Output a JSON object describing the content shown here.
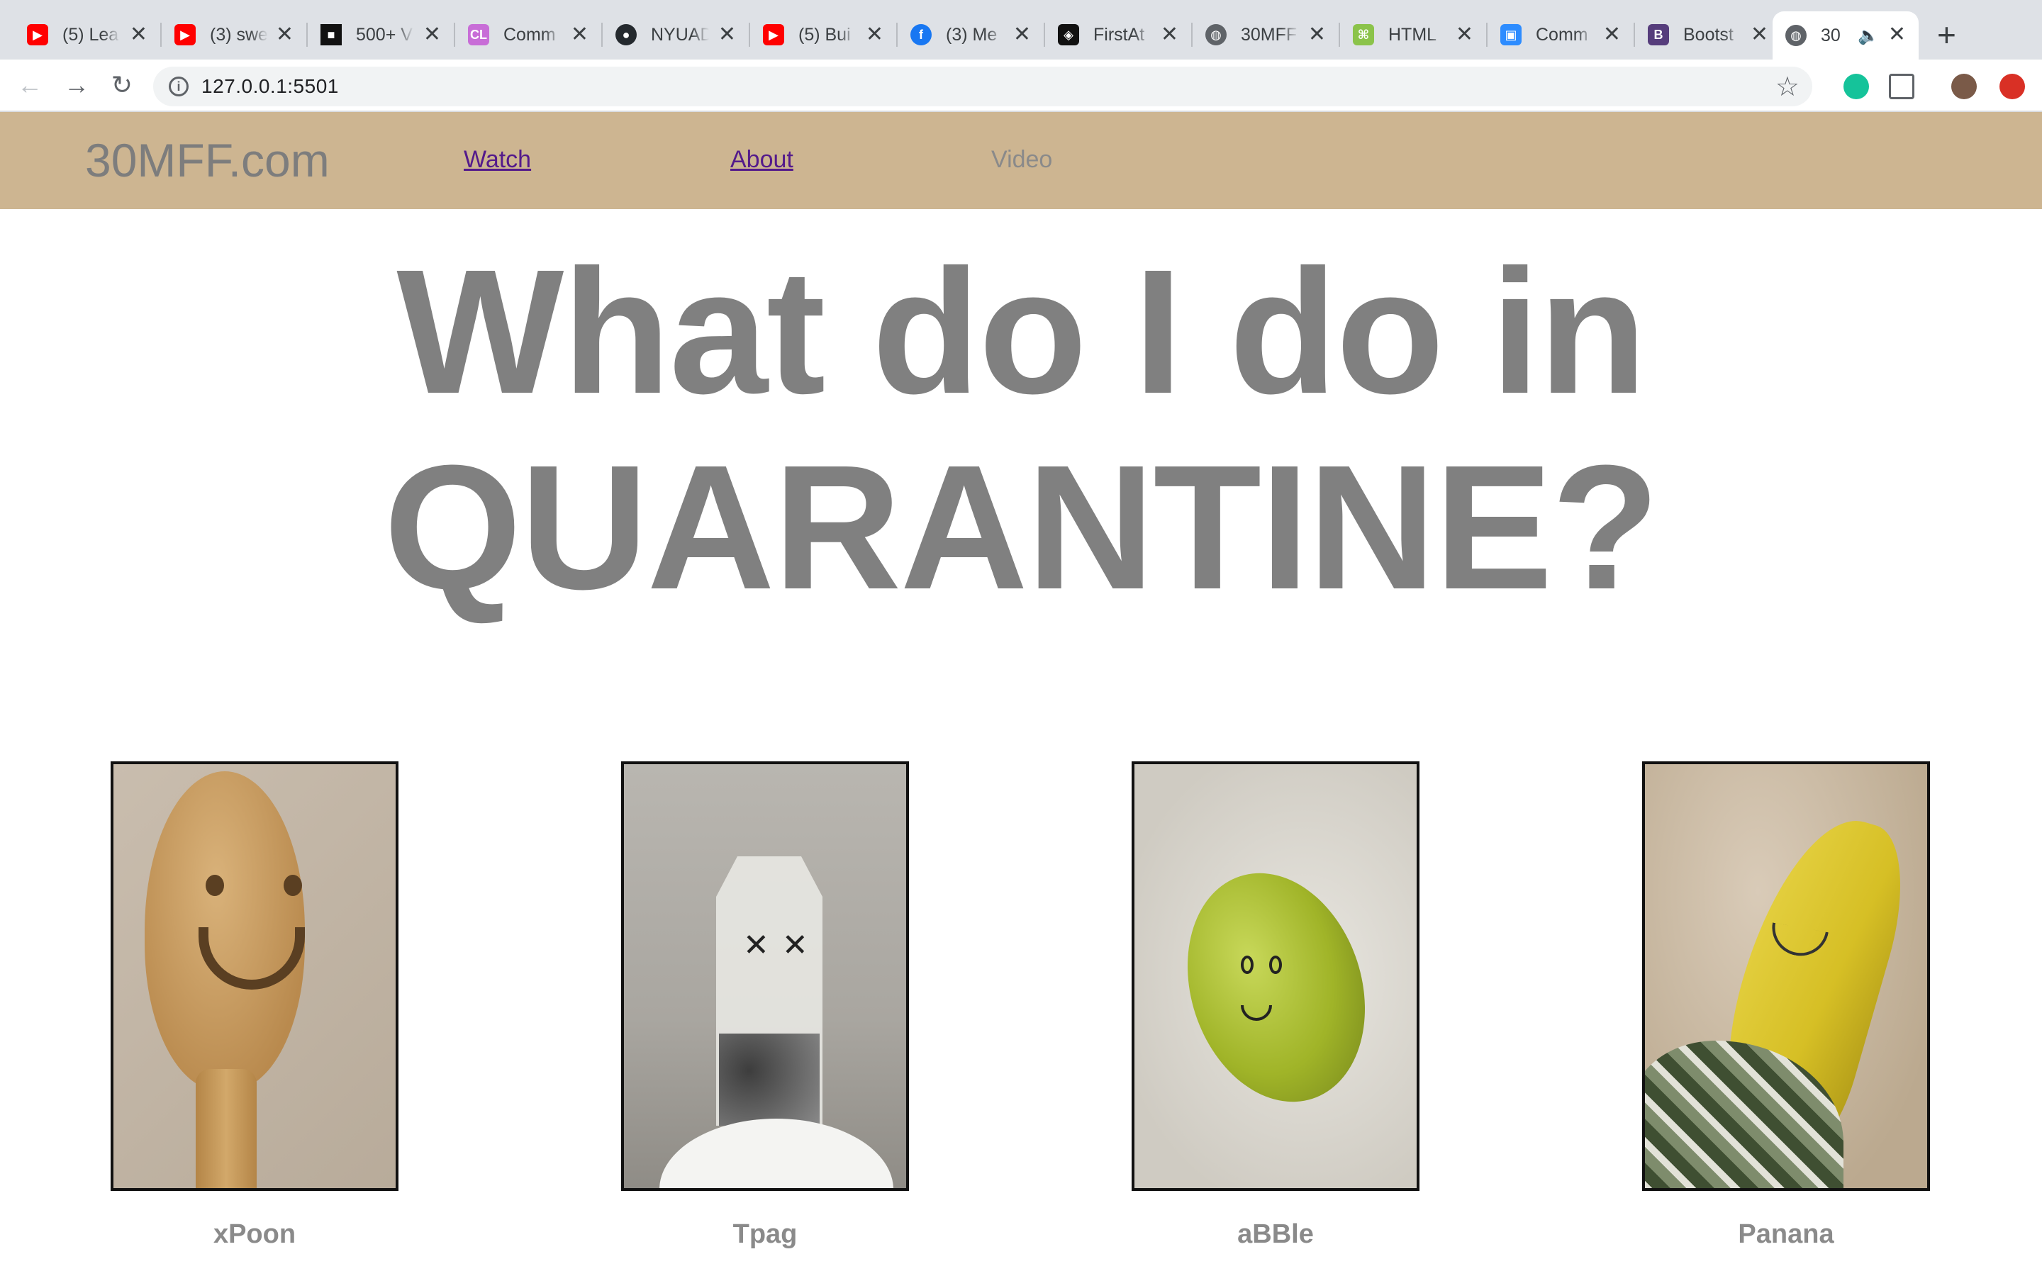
{
  "browser": {
    "tabs": [
      {
        "title": "(5) Lea",
        "icon": "youtube-icon",
        "color": "#ff0000"
      },
      {
        "title": "(3) swe",
        "icon": "youtube-icon",
        "color": "#ff0000"
      },
      {
        "title": "500+ V",
        "icon": "unsplash-icon",
        "color": "#111111"
      },
      {
        "title": "Comm",
        "icon": "cl-icon",
        "color": "#c86dd7"
      },
      {
        "title": "NYUAD",
        "icon": "github-icon",
        "color": "#24292e"
      },
      {
        "title": "(5) Bui",
        "icon": "youtube-icon",
        "color": "#ff0000"
      },
      {
        "title": "(3) Me",
        "icon": "facebook-icon",
        "color": "#1877f2"
      },
      {
        "title": "FirstAt",
        "icon": "codepen-icon",
        "color": "#111111"
      },
      {
        "title": "30MFF",
        "icon": "globe-icon",
        "color": "#5f6368"
      },
      {
        "title": "HTML",
        "icon": "html-icon",
        "color": "#8bc34a"
      },
      {
        "title": "Comm",
        "icon": "zoom-icon",
        "color": "#2d8cff"
      },
      {
        "title": "Bootst",
        "icon": "bootstrap-icon",
        "color": "#563d7c"
      },
      {
        "title": "30",
        "icon": "globe-icon",
        "color": "#5f6368",
        "active": true
      }
    ],
    "url": "127.0.0.1:5501",
    "new_tab_symbol": "+"
  },
  "site": {
    "brand": "30MFF.com",
    "nav": [
      {
        "label": "Watch"
      },
      {
        "label": "About"
      },
      {
        "label": "Video"
      }
    ],
    "headline_line1": "What do I do in",
    "headline_line2": "QUARANTINE?",
    "cards": [
      {
        "caption": "xPoon",
        "image": "wooden-spoon-smiley"
      },
      {
        "caption": "Tpag",
        "image": "teabag-face"
      },
      {
        "caption": "aBBle",
        "image": "green-apple-face"
      },
      {
        "caption": "Panana",
        "image": "banana-face"
      }
    ]
  }
}
